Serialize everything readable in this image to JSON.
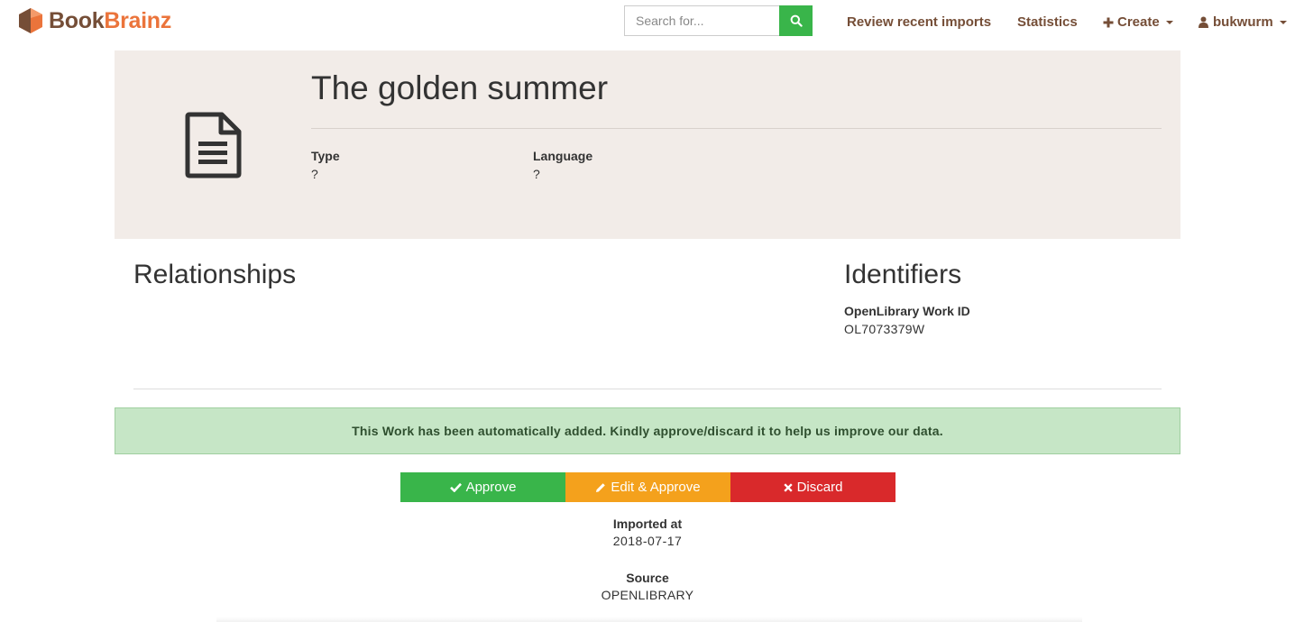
{
  "brand": {
    "part1": "Book",
    "part2": "Brainz"
  },
  "search": {
    "placeholder": "Search for..."
  },
  "nav": {
    "review_imports": "Review recent imports",
    "statistics": "Statistics",
    "create": "Create",
    "user": "bukwurm"
  },
  "entity": {
    "title": "The golden summer",
    "fields": [
      {
        "label": "Type",
        "value": "?"
      },
      {
        "label": "Language",
        "value": "?"
      }
    ]
  },
  "relationships": {
    "title": "Relationships"
  },
  "identifiers": {
    "title": "Identifiers",
    "items": [
      {
        "label": "OpenLibrary Work ID",
        "value": "OL7073379W"
      }
    ]
  },
  "alert": {
    "text": "This Work has been automatically added. Kindly approve/discard it to help us improve our data."
  },
  "actions": {
    "approve": "Approve",
    "edit_approve": "Edit & Approve",
    "discard": "Discard"
  },
  "meta": {
    "imported_label": "Imported at",
    "imported_value": "2018-07-17",
    "source_label": "Source",
    "source_value": "OPENLIBRARY"
  },
  "icons": {
    "logo": "bookbrainz-hexagon-logo",
    "search": "search-icon",
    "create": "plus-icon",
    "user": "user-icon",
    "work": "document-icon",
    "approve": "check-icon",
    "edit": "pencil-icon",
    "discard": "times-icon"
  },
  "colors": {
    "brand_brown": "#754e37",
    "brand_orange": "#eb743b",
    "success": "#39b54a",
    "warning": "#f4a11c",
    "danger": "#d9292b",
    "header_bg": "#f2ece8",
    "alert_bg": "#c6e6c6"
  }
}
